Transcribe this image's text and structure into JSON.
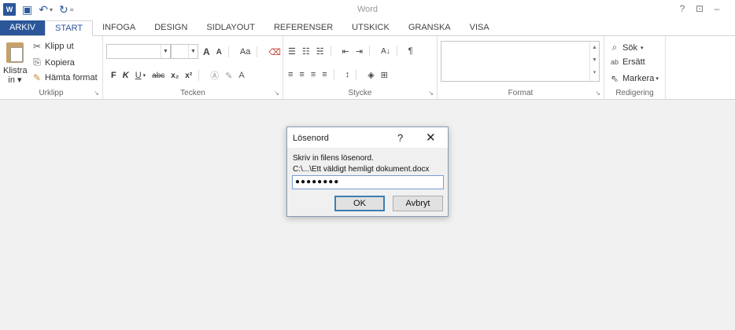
{
  "app": {
    "title": "Word",
    "logo": "W"
  },
  "window_controls": {
    "help": "?",
    "restore": "⊡",
    "minimize": "–"
  },
  "tabs": [
    "ARKIV",
    "START",
    "INFOGA",
    "DESIGN",
    "SIDLAYOUT",
    "REFERENSER",
    "UTSKICK",
    "GRANSKA",
    "VISA"
  ],
  "ribbon": {
    "clipboard": {
      "paste_label": "Klistra in ▾",
      "cut": "Klipp ut",
      "copy": "Kopiera",
      "format_painter": "Hämta format",
      "group_label": "Urklipp"
    },
    "font": {
      "font_name": "",
      "font_size": "",
      "grow": "A",
      "shrink": "A",
      "change_case": "Aa",
      "bold": "F",
      "italic": "K",
      "underline": "U",
      "strike": "abc",
      "subscript": "x₂",
      "superscript": "x²",
      "group_label": "Tecken"
    },
    "paragraph": {
      "sort": "A↓",
      "pilcrow": "¶",
      "group_label": "Stycke"
    },
    "styles": {
      "group_label": "Format"
    },
    "editing": {
      "find": "Sök",
      "replace": "Ersätt",
      "select": "Markera",
      "group_label": "Redigering"
    }
  },
  "dialog": {
    "title": "Lösenord",
    "help": "?",
    "close": "✕",
    "prompt": "Skriv in filens lösenord.",
    "path": "C:\\...\\Ett väldigt hemligt dokument.docx",
    "password_masked": "●●●●●●●●",
    "ok_label": "OK",
    "cancel_label": "Avbryt"
  },
  "colors": {
    "accent": "#2b579a",
    "ribbon_bg": "#ffffff",
    "canvas_bg": "#f1f1f1"
  }
}
